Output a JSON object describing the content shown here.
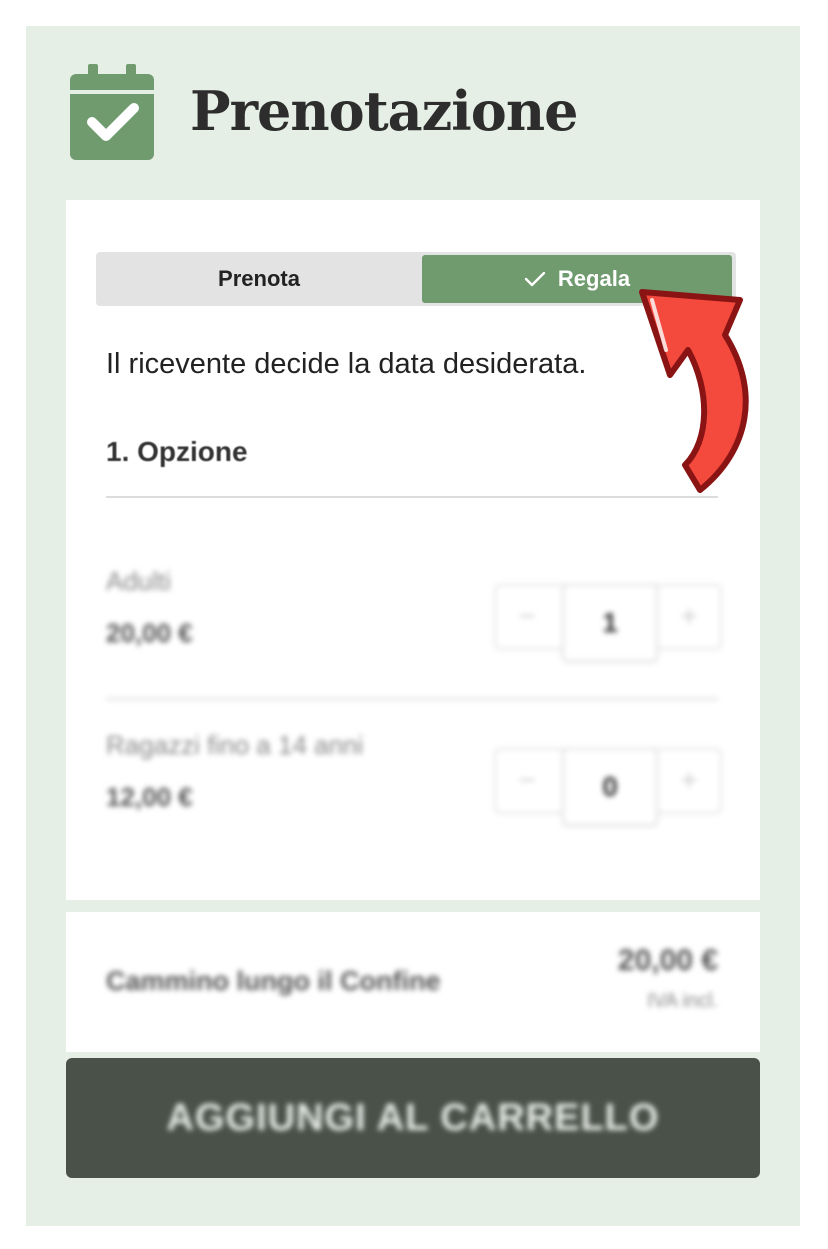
{
  "header": {
    "title": "Prenotazione",
    "icon": "calendar-check-icon"
  },
  "mode_toggle": {
    "options": [
      {
        "label": "Prenota",
        "selected": false
      },
      {
        "label": "Regala",
        "selected": true
      }
    ]
  },
  "info_text": "Il ricevente decide la data desiderata.",
  "section": {
    "heading": "1. Opzione"
  },
  "tickets": [
    {
      "label": "Adulti",
      "price": "20,00 €",
      "quantity": "1",
      "minus": "−",
      "plus": "+"
    },
    {
      "label": "Ragazzi fino a 14 anni",
      "price": "12,00 €",
      "quantity": "0",
      "minus": "−",
      "plus": "+"
    }
  ],
  "summary": {
    "name": "Cammino lungo il Confine",
    "price": "20,00 €",
    "tax_note": "IVA incl."
  },
  "cart_button": {
    "label": "AGGIUNGI AL CARRELLO"
  },
  "colors": {
    "accent": "#6f9b6f",
    "panel_bg": "#e6efe6",
    "button_dark": "#4a5149",
    "arrow_red": "#f44a3e"
  }
}
